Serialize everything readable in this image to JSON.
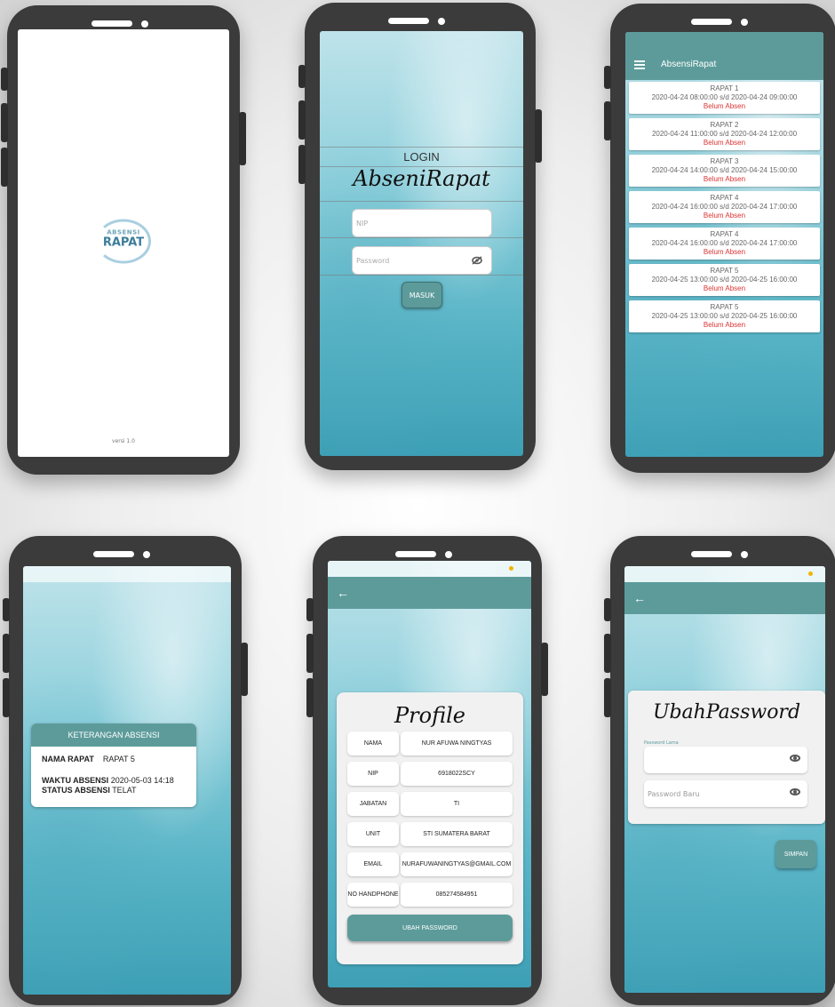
{
  "splash": {
    "logo_line1": "ABSENSI",
    "logo_line2": "RAPAT",
    "version": "versi 1.0"
  },
  "login": {
    "title": "LOGIN",
    "app_script": "AbseniRapat",
    "nip_placeholder": "NIP",
    "password_placeholder": "Password",
    "submit_label": "MASUK"
  },
  "meeting_list": {
    "appbar_title": "AbsensiRapat",
    "items": [
      {
        "title": "RAPAT 1",
        "range": "2020-04-24 08:00:00 s/d 2020-04-24 09:00:00",
        "status": "Belum Absen"
      },
      {
        "title": "RAPAT 2",
        "range": "2020-04-24 11:00:00 s/d 2020-04-24 12:00:00",
        "status": "Belum Absen"
      },
      {
        "title": "RAPAT 3",
        "range": "2020-04-24 14:00:00 s/d 2020-04-24 15:00:00",
        "status": "Belum Absen"
      },
      {
        "title": "RAPAT 4",
        "range": "2020-04-24 16:00:00 s/d 2020-04-24 17:00:00",
        "status": "Belum Absen"
      },
      {
        "title": "RAPAT 4",
        "range": "2020-04-24 16:00:00 s/d 2020-04-24 17:00:00",
        "status": "Belum Absen"
      },
      {
        "title": "RAPAT 5",
        "range": "2020-04-25 13:00:00 s/d 2020-04-25 16:00:00",
        "status": "Belum Absen"
      },
      {
        "title": "RAPAT 5",
        "range": "2020-04-25 13:00:00 s/d 2020-04-25 16:00:00",
        "status": "Belum Absen"
      }
    ]
  },
  "keterangan": {
    "header": "KETERANGAN ABSENSI",
    "rows": [
      {
        "label": "NAMA RAPAT",
        "value": "RAPAT 5"
      },
      {
        "label": "WAKTU ABSENSI",
        "value": "2020-05-03 14:18"
      },
      {
        "label": "STATUS ABSENSI",
        "value": "TELAT"
      }
    ]
  },
  "profile": {
    "title": "Profile",
    "rows": [
      {
        "label": "NAMA",
        "value": "NUR AFUWA NINGTYAS"
      },
      {
        "label": "NIP",
        "value": "6918022SCY"
      },
      {
        "label": "JABATAN",
        "value": "TI"
      },
      {
        "label": "UNIT",
        "value": "STI SUMATERA BARAT"
      },
      {
        "label": "EMAIL",
        "value": "NURAFUWANINGTYAS@GMAIL.COM"
      },
      {
        "label": "NO HANDPHONE",
        "value": "085274584951"
      }
    ],
    "button_label": "UBAH PASSWORD"
  },
  "ubah_password": {
    "title": "UbahPassword",
    "old_label": "Password Lama",
    "new_placeholder": "Password Baru",
    "submit_label": "SIMPAN"
  },
  "colors": {
    "accent": "#5d9b9b",
    "status_red": "#d33333",
    "phone_frame": "#3b3b3b"
  },
  "icons": [
    "back-arrow-icon",
    "menu-icon",
    "eye-icon",
    "eye-off-icon"
  ]
}
